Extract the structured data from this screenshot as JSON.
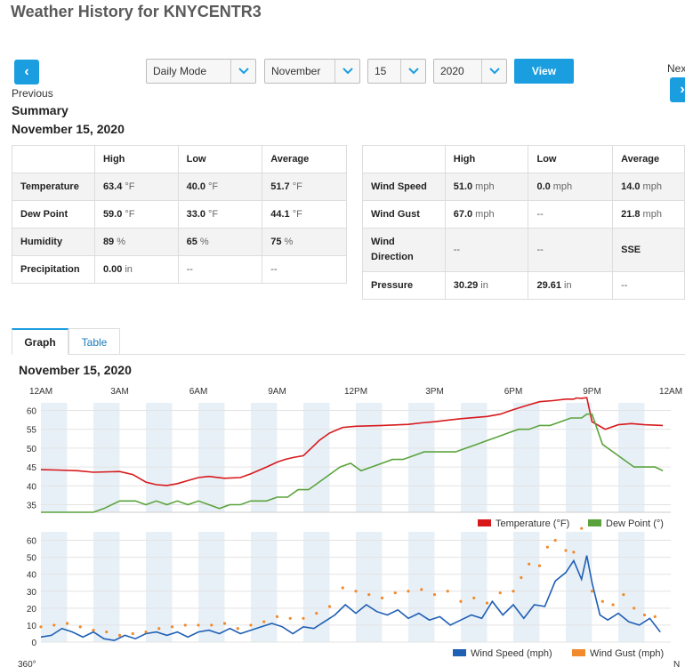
{
  "page": {
    "title": "Weather History for KNYCENTR3"
  },
  "nav": {
    "previous_label": "Previous",
    "next_label": "Next",
    "mode": "Daily Mode",
    "month": "November",
    "day": "15",
    "year": "2020",
    "view_label": "View"
  },
  "summary": {
    "title": "Summary",
    "date": "November 15, 2020",
    "left_headers": [
      "",
      "High",
      "Low",
      "Average"
    ],
    "left_rows": [
      {
        "label": "Temperature",
        "high": "63.4",
        "high_unit": "°F",
        "low": "40.0",
        "low_unit": "°F",
        "avg": "51.7",
        "avg_unit": "°F"
      },
      {
        "label": "Dew Point",
        "high": "59.0",
        "high_unit": "°F",
        "low": "33.0",
        "low_unit": "°F",
        "avg": "44.1",
        "avg_unit": "°F"
      },
      {
        "label": "Humidity",
        "high": "89",
        "high_unit": "%",
        "low": "65",
        "low_unit": "%",
        "avg": "75",
        "avg_unit": "%"
      },
      {
        "label": "Precipitation",
        "high": "0.00",
        "high_unit": "in",
        "low": "--",
        "low_unit": "",
        "avg": "--",
        "avg_unit": ""
      }
    ],
    "right_headers": [
      "",
      "High",
      "Low",
      "Average"
    ],
    "right_rows": [
      {
        "label": "Wind Speed",
        "high": "51.0",
        "high_unit": "mph",
        "low": "0.0",
        "low_unit": "mph",
        "avg": "14.0",
        "avg_unit": "mph"
      },
      {
        "label": "Wind Gust",
        "high": "67.0",
        "high_unit": "mph",
        "low": "--",
        "low_unit": "",
        "avg": "21.8",
        "avg_unit": "mph"
      },
      {
        "label": "Wind\nDirection",
        "high": "--",
        "high_unit": "",
        "low": "--",
        "low_unit": "",
        "avg": "SSE",
        "avg_unit": ""
      },
      {
        "label": "Pressure",
        "high": "30.29",
        "high_unit": "in",
        "low": "29.61",
        "low_unit": "in",
        "avg": "--",
        "avg_unit": ""
      }
    ]
  },
  "tabs": [
    {
      "label": "Graph",
      "active": true
    },
    {
      "label": "Table",
      "active": false
    }
  ],
  "graph_date": "November 15, 2020",
  "colors": {
    "accent": "#1a9ee0",
    "temperature": "#d7191c",
    "dewpoint": "#5aa33c",
    "wind_speed": "#1f5fb4",
    "wind_gust": "#f08a2c",
    "band": "#e8f0f7"
  },
  "chart_data": [
    {
      "type": "line",
      "x_ticks": [
        "12AM",
        "3AM",
        "6AM",
        "9AM",
        "12PM",
        "3PM",
        "6PM",
        "9PM",
        "12AM"
      ],
      "xlim": [
        0,
        24
      ],
      "ylim": [
        33,
        62
      ],
      "yticks": [
        35,
        40,
        45,
        50,
        55,
        60
      ],
      "grid": true,
      "legend": "bottom-right",
      "series": [
        {
          "name": "Temperature (°F)",
          "x": [
            0,
            0.6,
            1.4,
            2,
            3,
            3.5,
            4,
            4.4,
            4.8,
            5.2,
            5.6,
            6,
            6.4,
            7,
            7.6,
            8,
            8.6,
            9,
            9.3,
            9.6,
            10,
            10.3,
            10.6,
            11,
            11.5,
            12,
            13,
            14,
            14.5,
            15,
            16,
            17,
            17.5,
            18,
            18.5,
            19,
            19.5,
            20,
            20.3,
            20.4,
            20.6,
            20.8,
            21,
            21.5,
            22,
            22.5,
            23,
            23.7
          ],
          "y": [
            44.3,
            44.2,
            44,
            43.6,
            43.8,
            43,
            41,
            40.3,
            40.1,
            40.6,
            41.4,
            42.2,
            42.5,
            42,
            42.2,
            43.2,
            45,
            46.3,
            47,
            47.5,
            48,
            50,
            52,
            54,
            55.5,
            55.8,
            56,
            56.3,
            56.7,
            57,
            57.8,
            58.4,
            59,
            60.2,
            61.3,
            62.3,
            62.6,
            63,
            63,
            63.3,
            63.2,
            63.4,
            57,
            55,
            56.2,
            56.5,
            56.2,
            56
          ]
        },
        {
          "name": "Dew Point (°)",
          "x": [
            0,
            1,
            2,
            2.4,
            3,
            3.6,
            4,
            4.4,
            4.8,
            5.2,
            5.6,
            6,
            6.4,
            6.8,
            7.2,
            7.6,
            8,
            8.6,
            9,
            9.4,
            9.8,
            10.2,
            10.6,
            11,
            11.4,
            11.8,
            12.2,
            12.6,
            13,
            13.4,
            13.8,
            14.2,
            14.6,
            15,
            15.4,
            15.8,
            16.2,
            16.6,
            17,
            17.4,
            17.8,
            18.2,
            18.6,
            19,
            19.4,
            19.8,
            20.2,
            20.6,
            20.8,
            21,
            21.4,
            21.8,
            22.2,
            22.6,
            23,
            23.4,
            23.7
          ],
          "y": [
            33,
            33,
            33,
            34,
            36,
            36,
            35,
            36,
            35,
            36,
            35,
            36,
            35,
            34,
            35,
            35,
            36,
            36,
            37,
            37,
            39,
            39,
            41,
            43,
            45,
            46,
            44,
            45,
            46,
            47,
            47,
            48,
            49,
            49,
            49,
            49,
            50,
            51,
            52,
            53,
            54,
            55,
            55,
            56,
            56,
            57,
            58,
            58,
            59,
            59,
            51,
            49,
            47,
            45,
            45,
            45,
            44
          ]
        }
      ]
    },
    {
      "type": "line",
      "x_ticks": [
        "12AM",
        "3AM",
        "6AM",
        "9AM",
        "12PM",
        "3PM",
        "6PM",
        "9PM",
        "12AM"
      ],
      "xlim": [
        0,
        24
      ],
      "ylim": [
        0,
        65
      ],
      "yticks": [
        0,
        10,
        20,
        30,
        40,
        50,
        60
      ],
      "grid": true,
      "legend": "bottom-right",
      "series": [
        {
          "name": "Wind Speed (mph)",
          "x": [
            0,
            0.4,
            0.8,
            1.2,
            1.6,
            2,
            2.4,
            2.8,
            3.2,
            3.6,
            4,
            4.4,
            4.8,
            5.2,
            5.6,
            6,
            6.4,
            6.8,
            7.2,
            7.6,
            8,
            8.4,
            8.8,
            9.2,
            9.6,
            10,
            10.4,
            10.8,
            11.2,
            11.6,
            12,
            12.4,
            12.8,
            13.2,
            13.6,
            14,
            14.4,
            14.8,
            15.2,
            15.6,
            16,
            16.4,
            16.8,
            17.2,
            17.6,
            18,
            18.4,
            18.8,
            19.2,
            19.6,
            20,
            20.3,
            20.6,
            20.8,
            21,
            21.3,
            21.6,
            22,
            22.4,
            22.8,
            23.2,
            23.6
          ],
          "y": [
            3,
            4,
            8,
            6,
            3,
            6,
            2,
            1,
            4,
            2,
            5,
            6,
            4,
            6,
            3,
            6,
            7,
            5,
            8,
            5,
            7,
            9,
            11,
            9,
            5,
            9,
            8,
            12,
            16,
            22,
            17,
            22,
            18,
            16,
            19,
            14,
            17,
            13,
            15,
            10,
            13,
            16,
            14,
            24,
            16,
            22,
            14,
            22,
            21,
            36,
            41,
            48,
            37,
            51,
            35,
            16,
            13,
            17,
            12,
            10,
            14,
            6
          ]
        },
        {
          "name": "Wind Gust (mph)",
          "x": [
            0,
            0.5,
            1,
            1.5,
            2,
            2.5,
            3,
            3.5,
            4,
            4.5,
            5,
            5.5,
            6,
            6.5,
            7,
            7.5,
            8,
            8.5,
            9,
            9.5,
            10,
            10.5,
            11,
            11.5,
            12,
            12.5,
            13,
            13.5,
            14,
            14.5,
            15,
            15.5,
            16,
            16.5,
            17,
            17.5,
            18,
            18.3,
            18.6,
            19,
            19.3,
            19.6,
            20,
            20.3,
            20.6,
            21,
            21.4,
            21.8,
            22.2,
            22.6,
            23,
            23.4
          ],
          "y": [
            9,
            10,
            11,
            9,
            7,
            6,
            4,
            5,
            6,
            8,
            9,
            10,
            10,
            10,
            11,
            8,
            10,
            12,
            15,
            14,
            14,
            17,
            21,
            32,
            30,
            28,
            26,
            29,
            30,
            31,
            28,
            30,
            24,
            26,
            23,
            29,
            30,
            38,
            46,
            45,
            56,
            60,
            54,
            53,
            67,
            30,
            24,
            22,
            28,
            20,
            16,
            15
          ]
        }
      ]
    }
  ],
  "lower_axis_label": "360°",
  "lower_axis_label_right": "N"
}
